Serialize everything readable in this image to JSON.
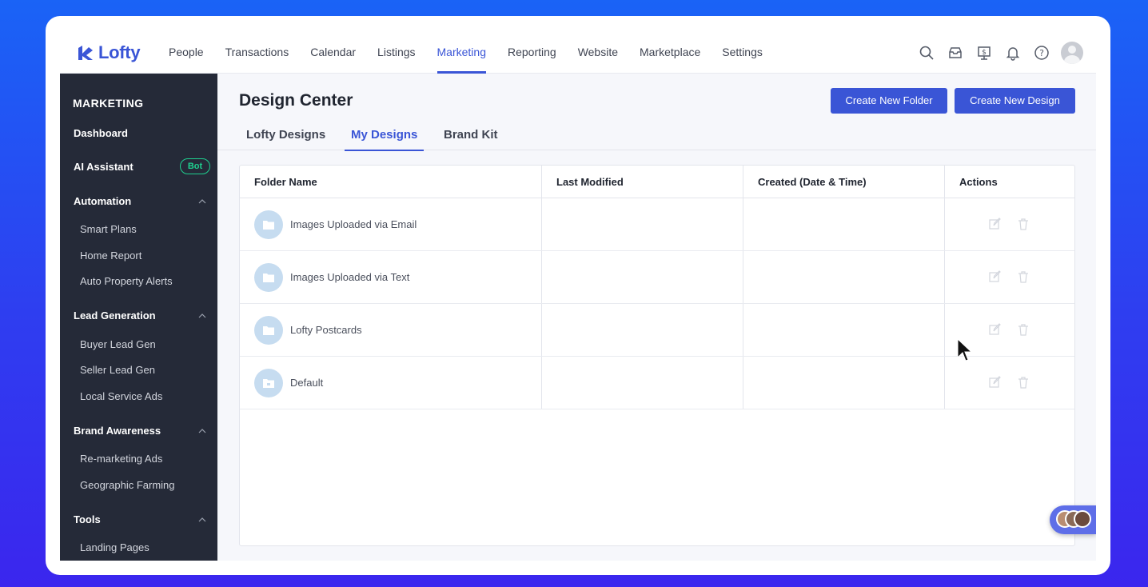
{
  "brand": {
    "name": "Lofty",
    "accent": "#3a55d6"
  },
  "nav": {
    "items": [
      {
        "label": "People"
      },
      {
        "label": "Transactions"
      },
      {
        "label": "Calendar"
      },
      {
        "label": "Listings"
      },
      {
        "label": "Marketing",
        "active": true
      },
      {
        "label": "Reporting"
      },
      {
        "label": "Website"
      },
      {
        "label": "Marketplace"
      },
      {
        "label": "Settings"
      }
    ],
    "icons": [
      "search-icon",
      "inbox-icon",
      "billing-icon",
      "bell-icon",
      "help-icon",
      "avatar"
    ]
  },
  "sidebar": {
    "title": "MARKETING",
    "dashboard": "Dashboard",
    "ai_assistant": "AI Assistant",
    "ai_badge": "Bot",
    "automation": {
      "label": "Automation",
      "items": [
        "Smart Plans",
        "Home Report",
        "Auto Property Alerts"
      ]
    },
    "lead_generation": {
      "label": "Lead Generation",
      "items": [
        "Buyer Lead Gen",
        "Seller Lead Gen",
        "Local Service Ads"
      ]
    },
    "brand_awareness": {
      "label": "Brand Awareness",
      "items": [
        "Re-marketing Ads",
        "Geographic Farming"
      ]
    },
    "tools": {
      "label": "Tools",
      "items": [
        "Landing Pages"
      ]
    }
  },
  "main": {
    "title": "Design Center",
    "create_folder": "Create New Folder",
    "create_design": "Create New Design",
    "tabs": [
      "Lofty Designs",
      "My Designs",
      "Brand Kit"
    ],
    "active_tab": "My Designs"
  },
  "table": {
    "headers": [
      "Folder Name",
      "Last Modified",
      "Created (Date & Time)",
      "Actions"
    ],
    "rows": [
      {
        "name": "Images Uploaded via Email",
        "last_modified": "",
        "created": ""
      },
      {
        "name": "Images Uploaded via Text",
        "last_modified": "",
        "created": ""
      },
      {
        "name": "Lofty Postcards",
        "last_modified": "",
        "created": ""
      },
      {
        "name": "Default",
        "last_modified": "",
        "created": ""
      }
    ]
  }
}
